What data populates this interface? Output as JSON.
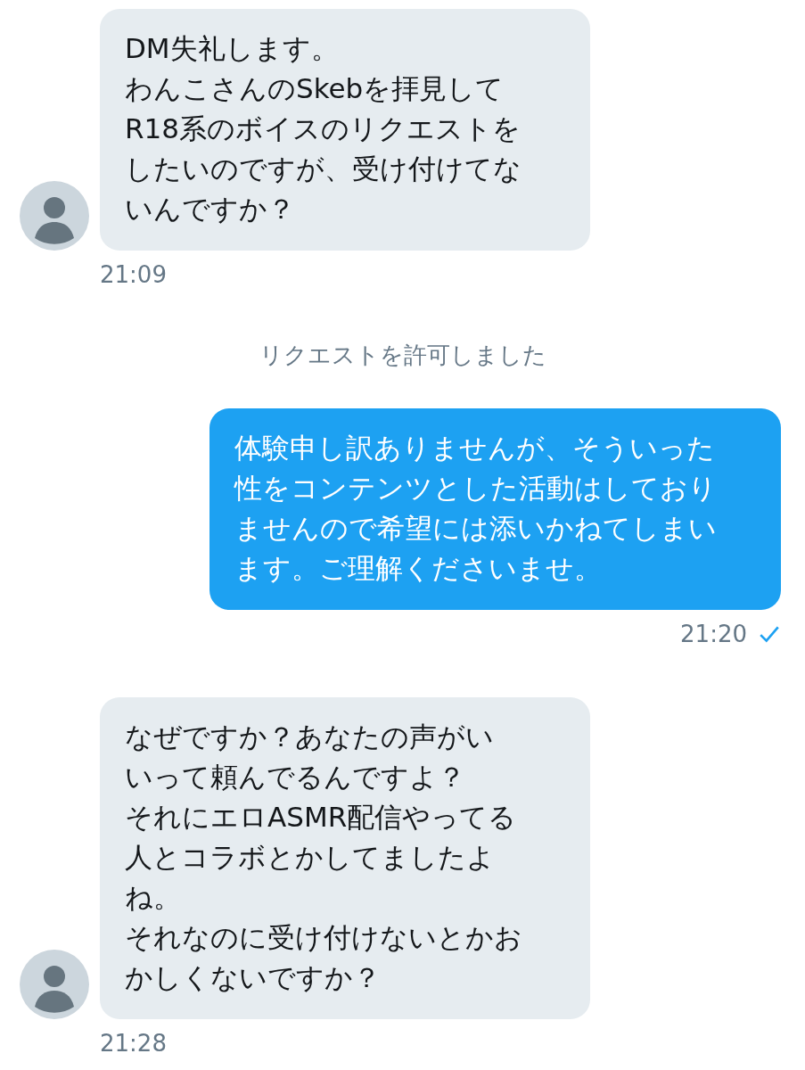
{
  "messages": [
    {
      "kind": "incoming",
      "lines": [
        "DM失礼します。",
        "わんこさんのSkebを拝見して",
        "R18系のボイスのリクエストを",
        "したいのですが、受け付けてな",
        "いんですか？"
      ],
      "time": "21:09"
    },
    {
      "kind": "system",
      "text": "リクエストを許可しました"
    },
    {
      "kind": "outgoing",
      "lines": [
        "体験申し訳ありませんが、そういった",
        "性をコンテンツとした活動はしており",
        "ませんので希望には添いかねてしまい",
        "ます。ご理解くださいませ。"
      ],
      "time": "21:20",
      "read": true
    },
    {
      "kind": "incoming",
      "lines": [
        "なぜですか？あなたの声がい",
        "いって頼んでるんですよ？",
        "それにエロASMR配信やってる",
        "人とコラボとかしてましたよ",
        "ね。",
        "それなのに受け付けないとかお",
        "かしくないですか？"
      ],
      "time": "21:28"
    }
  ]
}
